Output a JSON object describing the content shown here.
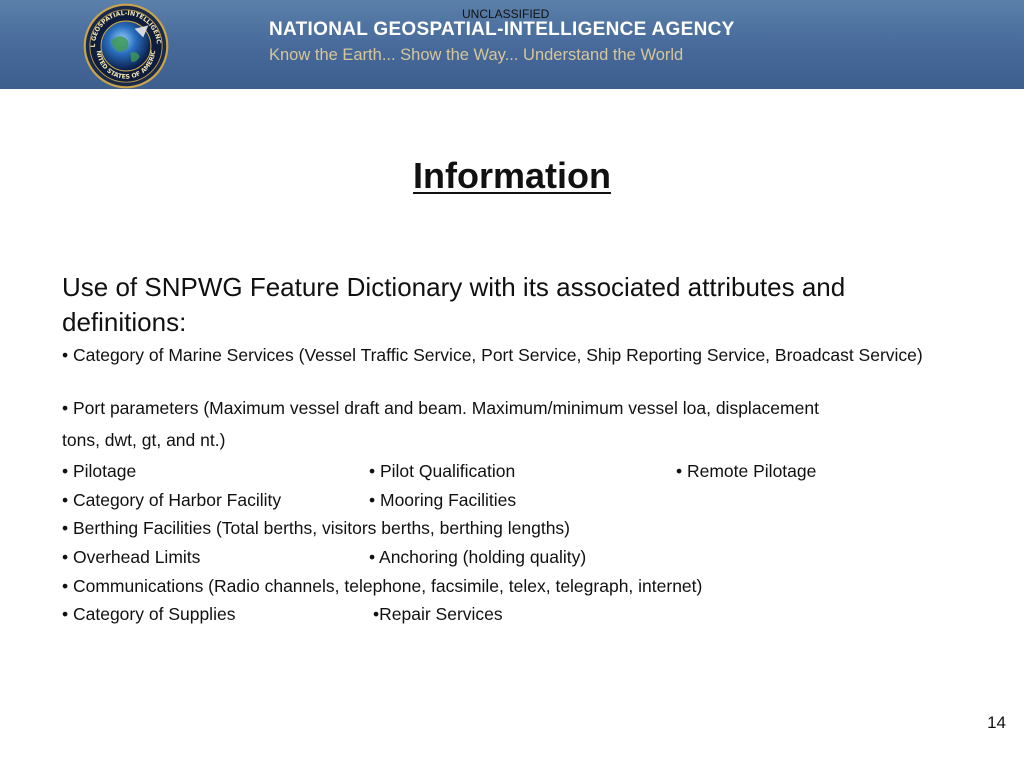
{
  "header": {
    "agency_name": "NATIONAL GEOSPATIAL-INTELLIGENCE AGENCY",
    "motto": "Know the Earth... Show the Way... Understand the World",
    "classification": "UNCLASSIFIED",
    "seal": {
      "icon": "agency-seal-icon",
      "ring_text_top": "NATIONAL GEOSPATIAL-INTELLIGENCE AGENCY",
      "ring_text_bottom": "UNITED STATES OF AMERICA"
    }
  },
  "slide": {
    "title": "Information",
    "intro": "Use of SNPWG Feature Dictionary with its associated attributes and definitions:",
    "bullets": {
      "marine_services": "• Category of Marine Services (Vessel Traffic Service, Port Service, Ship Reporting Service, Broadcast Service)",
      "port_parameters_1": "• Port parameters (Maximum vessel draft and beam. Maximum/minimum vessel loa, displacement",
      "port_parameters_2": "tons, dwt, gt, and nt.)",
      "pilotage": "• Pilotage",
      "pilot_qualification": "• Pilot Qualification",
      "remote_pilotage": "• Remote Pilotage",
      "harbor_facility": "• Category of Harbor Facility",
      "mooring_facilities": "• Mooring Facilities",
      "berthing_facilities": "• Berthing Facilities (Total berths, visitors berths, berthing lengths)",
      "overhead_limits": "• Overhead Limits",
      "anchoring": "• Anchoring (holding quality)",
      "communications": "• Communications (Radio channels, telephone, facsimile, telex, telegraph, internet)",
      "supplies": "• Category of Supplies",
      "repair_services": "•Repair Services"
    }
  },
  "footer": {
    "page_number": "14"
  },
  "colors": {
    "banner_blue": "#4a6d9c",
    "agency_name_white": "#ffffff",
    "motto_gold": "#d6c69a",
    "text": "#111111"
  }
}
